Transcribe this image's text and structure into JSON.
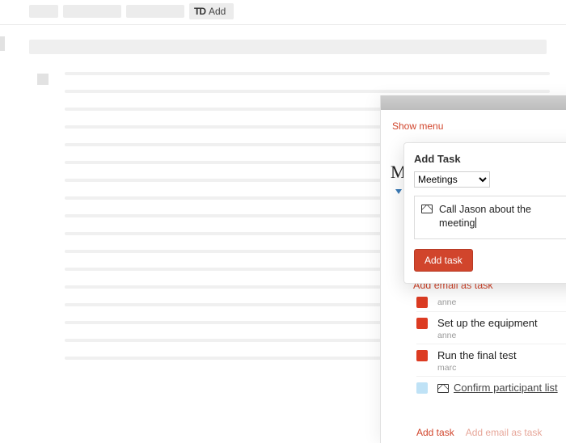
{
  "toolbar": {
    "add_label": "Add",
    "logo_glyph": "TD"
  },
  "panel": {
    "show_menu": "Show menu",
    "peek_initial": "M"
  },
  "popover": {
    "title": "Add Task",
    "project_selected": "Meetings",
    "task_text": "Call Jason about the meeting",
    "add_button": "Add task"
  },
  "links": {
    "add_email_as_task": "Add email as task",
    "add_task": "Add task",
    "add_email_as_task_bottom": "Add email as task"
  },
  "tasks": [
    {
      "title_partial": "",
      "assignee": "anne",
      "color": "red",
      "partial": true
    },
    {
      "title": "Set up the equipment",
      "assignee": "anne",
      "color": "red"
    },
    {
      "title": "Run the final test",
      "assignee": "marc",
      "color": "red"
    },
    {
      "title": "Confirm participant list",
      "color": "blue",
      "email": true
    }
  ]
}
